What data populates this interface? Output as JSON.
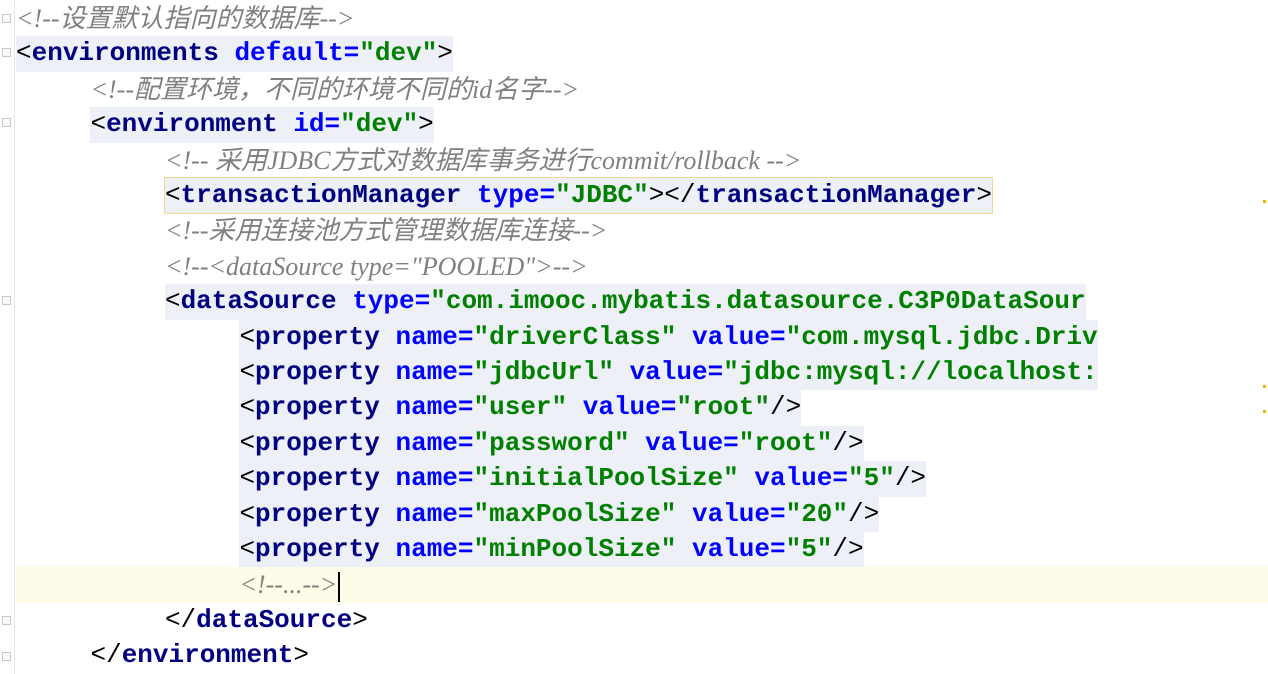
{
  "editor": {
    "lines": [
      {
        "indent": 0,
        "kind": "comment",
        "text": "<!--设置默认指向的数据库-->"
      },
      {
        "indent": 0,
        "kind": "tag",
        "tag": "environments",
        "attrs": [
          {
            "name": "default",
            "value": "\"dev\""
          }
        ],
        "tail": ">"
      },
      {
        "indent": 2,
        "kind": "comment",
        "text": "<!--配置环境，不同的环境不同的id名字-->"
      },
      {
        "indent": 2,
        "kind": "tag",
        "tag": "environment",
        "attrs": [
          {
            "name": "id",
            "value": "\"dev\""
          }
        ],
        "tail": ">"
      },
      {
        "indent": 4,
        "kind": "comment",
        "text": "<!-- 采用JDBC方式对数据库事务进行commit/rollback -->"
      },
      {
        "indent": 4,
        "kind": "tag",
        "tag": "transactionManager",
        "attrs": [
          {
            "name": "type",
            "value": "\"JDBC\""
          }
        ],
        "tail": "></",
        "closeTag": "transactionManager",
        "closeTail": ">",
        "highlight": true
      },
      {
        "indent": 4,
        "kind": "comment",
        "text": "<!--采用连接池方式管理数据库连接-->"
      },
      {
        "indent": 4,
        "kind": "comment",
        "text": "<!--<dataSource type=\"POOLED\">-->"
      },
      {
        "indent": 4,
        "kind": "tag",
        "tag": "dataSource",
        "attrs": [
          {
            "name": "type",
            "value": "\"com.imooc.mybatis.datasource.C3P0DataSour"
          }
        ],
        "tail": ""
      },
      {
        "indent": 6,
        "kind": "tag",
        "tag": "property",
        "attrs": [
          {
            "name": "name",
            "value": "\"driverClass\""
          },
          {
            "name": "value",
            "value": "\"com.mysql.jdbc.Driv"
          }
        ],
        "tail": ""
      },
      {
        "indent": 6,
        "kind": "tag",
        "tag": "property",
        "attrs": [
          {
            "name": "name",
            "value": "\"jdbcUrl\""
          },
          {
            "name": "value",
            "value": "\"jdbc:mysql://localhost:"
          }
        ],
        "tail": ""
      },
      {
        "indent": 6,
        "kind": "tag",
        "tag": "property",
        "attrs": [
          {
            "name": "name",
            "value": "\"user\""
          },
          {
            "name": "value",
            "value": "\"root\""
          }
        ],
        "tail": "/>"
      },
      {
        "indent": 6,
        "kind": "tag",
        "tag": "property",
        "attrs": [
          {
            "name": "name",
            "value": "\"password\""
          },
          {
            "name": "value",
            "value": "\"root\""
          }
        ],
        "tail": "/>"
      },
      {
        "indent": 6,
        "kind": "tag",
        "tag": "property",
        "attrs": [
          {
            "name": "name",
            "value": "\"initialPoolSize\""
          },
          {
            "name": "value",
            "value": "\"5\""
          }
        ],
        "tail": "/>"
      },
      {
        "indent": 6,
        "kind": "tag",
        "tag": "property",
        "attrs": [
          {
            "name": "name",
            "value": "\"maxPoolSize\""
          },
          {
            "name": "value",
            "value": "\"20\""
          }
        ],
        "tail": "/>"
      },
      {
        "indent": 6,
        "kind": "tag",
        "tag": "property",
        "attrs": [
          {
            "name": "name",
            "value": "\"minPoolSize\""
          },
          {
            "name": "value",
            "value": "\"5\""
          }
        ],
        "tail": "/>"
      },
      {
        "indent": 6,
        "kind": "comment",
        "text": "<!--...-->",
        "current": true,
        "caret": true
      },
      {
        "indent": 4,
        "kind": "close",
        "tag": "dataSource"
      },
      {
        "indent": 2,
        "kind": "close",
        "tag": "environment"
      }
    ]
  },
  "colors": {
    "tag": "#000080",
    "attribute": "#0000ff",
    "value": "#008000",
    "comment": "#808080",
    "current_line": "#fefbe8",
    "tag_highlight": "#fdeec3"
  }
}
